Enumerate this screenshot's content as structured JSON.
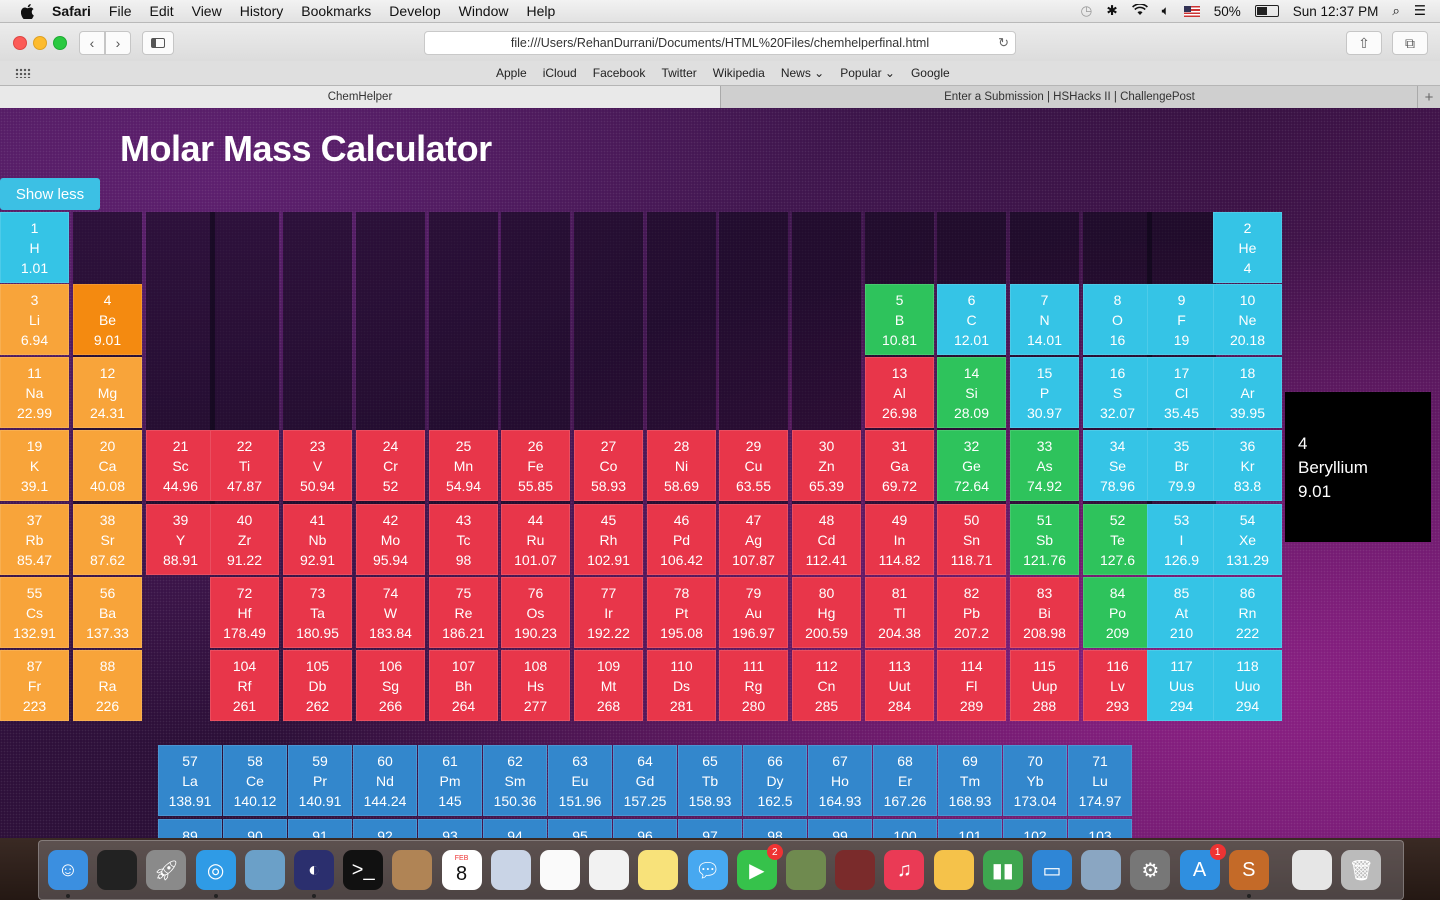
{
  "menubar": {
    "items": [
      "Safari",
      "File",
      "Edit",
      "View",
      "History",
      "Bookmarks",
      "Develop",
      "Window",
      "Help"
    ],
    "battery": "50%",
    "clock": "Sun 12:37 PM"
  },
  "toolbar": {
    "url": "file:///Users/RehanDurrani/Documents/HTML%20Files/chemhelperfinal.html"
  },
  "favorites": [
    "Apple",
    "iCloud",
    "Facebook",
    "Twitter",
    "Wikipedia",
    "News ⌄",
    "Popular ⌄",
    "Google"
  ],
  "tabs": [
    {
      "label": "ChemHelper",
      "active": true
    },
    {
      "label": "Enter a Submission | HSHacks II | ChallengePost",
      "active": false
    }
  ],
  "page": {
    "title": "Molar Mass Calculator",
    "show_less": "Show less"
  },
  "info_box": {
    "number": "4",
    "name": "Beryllium",
    "mass": "9.01"
  },
  "elements": [
    {
      "n": "1",
      "s": "H",
      "m": "1.01",
      "col": 1,
      "row": 1,
      "cat": "nonmetal"
    },
    {
      "n": "2",
      "s": "He",
      "m": "4",
      "col": 18,
      "row": 1,
      "cat": "nonmetal"
    },
    {
      "n": "3",
      "s": "Li",
      "m": "6.94",
      "col": 1,
      "row": 2,
      "cat": "alkali"
    },
    {
      "n": "4",
      "s": "Be",
      "m": "9.01",
      "col": 2,
      "row": 2,
      "cat": "selected"
    },
    {
      "n": "5",
      "s": "B",
      "m": "10.81",
      "col": 13,
      "row": 2,
      "cat": "metalloid"
    },
    {
      "n": "6",
      "s": "C",
      "m": "12.01",
      "col": 14,
      "row": 2,
      "cat": "nonmetal"
    },
    {
      "n": "7",
      "s": "N",
      "m": "14.01",
      "col": 15,
      "row": 2,
      "cat": "nonmetal"
    },
    {
      "n": "8",
      "s": "O",
      "m": "16",
      "col": 16,
      "row": 2,
      "cat": "nonmetal"
    },
    {
      "n": "9",
      "s": "F",
      "m": "19",
      "col": 17,
      "row": 2,
      "cat": "nonmetal"
    },
    {
      "n": "10",
      "s": "Ne",
      "m": "20.18",
      "col": 18,
      "row": 2,
      "cat": "nonmetal"
    },
    {
      "n": "11",
      "s": "Na",
      "m": "22.99",
      "col": 1,
      "row": 3,
      "cat": "alkali"
    },
    {
      "n": "12",
      "s": "Mg",
      "m": "24.31",
      "col": 2,
      "row": 3,
      "cat": "alkaline"
    },
    {
      "n": "13",
      "s": "Al",
      "m": "26.98",
      "col": 13,
      "row": 3,
      "cat": "transition"
    },
    {
      "n": "14",
      "s": "Si",
      "m": "28.09",
      "col": 14,
      "row": 3,
      "cat": "metalloid"
    },
    {
      "n": "15",
      "s": "P",
      "m": "30.97",
      "col": 15,
      "row": 3,
      "cat": "nonmetal"
    },
    {
      "n": "16",
      "s": "S",
      "m": "32.07",
      "col": 16,
      "row": 3,
      "cat": "nonmetal"
    },
    {
      "n": "17",
      "s": "Cl",
      "m": "35.45",
      "col": 17,
      "row": 3,
      "cat": "nonmetal"
    },
    {
      "n": "18",
      "s": "Ar",
      "m": "39.95",
      "col": 18,
      "row": 3,
      "cat": "nonmetal"
    },
    {
      "n": "19",
      "s": "K",
      "m": "39.1",
      "col": 1,
      "row": 4,
      "cat": "alkali"
    },
    {
      "n": "20",
      "s": "Ca",
      "m": "40.08",
      "col": 2,
      "row": 4,
      "cat": "alkaline"
    },
    {
      "n": "21",
      "s": "Sc",
      "m": "44.96",
      "col": 3,
      "row": 4,
      "cat": "transition"
    },
    {
      "n": "22",
      "s": "Ti",
      "m": "47.87",
      "col": 4,
      "row": 4,
      "cat": "transition"
    },
    {
      "n": "23",
      "s": "V",
      "m": "50.94",
      "col": 5,
      "row": 4,
      "cat": "transition"
    },
    {
      "n": "24",
      "s": "Cr",
      "m": "52",
      "col": 6,
      "row": 4,
      "cat": "transition"
    },
    {
      "n": "25",
      "s": "Mn",
      "m": "54.94",
      "col": 7,
      "row": 4,
      "cat": "transition"
    },
    {
      "n": "26",
      "s": "Fe",
      "m": "55.85",
      "col": 8,
      "row": 4,
      "cat": "transition"
    },
    {
      "n": "27",
      "s": "Co",
      "m": "58.93",
      "col": 9,
      "row": 4,
      "cat": "transition"
    },
    {
      "n": "28",
      "s": "Ni",
      "m": "58.69",
      "col": 10,
      "row": 4,
      "cat": "transition"
    },
    {
      "n": "29",
      "s": "Cu",
      "m": "63.55",
      "col": 11,
      "row": 4,
      "cat": "transition"
    },
    {
      "n": "30",
      "s": "Zn",
      "m": "65.39",
      "col": 12,
      "row": 4,
      "cat": "transition"
    },
    {
      "n": "31",
      "s": "Ga",
      "m": "69.72",
      "col": 13,
      "row": 4,
      "cat": "transition"
    },
    {
      "n": "32",
      "s": "Ge",
      "m": "72.64",
      "col": 14,
      "row": 4,
      "cat": "metalloid"
    },
    {
      "n": "33",
      "s": "As",
      "m": "74.92",
      "col": 15,
      "row": 4,
      "cat": "metalloid"
    },
    {
      "n": "34",
      "s": "Se",
      "m": "78.96",
      "col": 16,
      "row": 4,
      "cat": "nonmetal"
    },
    {
      "n": "35",
      "s": "Br",
      "m": "79.9",
      "col": 17,
      "row": 4,
      "cat": "nonmetal"
    },
    {
      "n": "36",
      "s": "Kr",
      "m": "83.8",
      "col": 18,
      "row": 4,
      "cat": "nonmetal"
    },
    {
      "n": "37",
      "s": "Rb",
      "m": "85.47",
      "col": 1,
      "row": 5,
      "cat": "alkali"
    },
    {
      "n": "38",
      "s": "Sr",
      "m": "87.62",
      "col": 2,
      "row": 5,
      "cat": "alkaline"
    },
    {
      "n": "39",
      "s": "Y",
      "m": "88.91",
      "col": 3,
      "row": 5,
      "cat": "transition"
    },
    {
      "n": "40",
      "s": "Zr",
      "m": "91.22",
      "col": 4,
      "row": 5,
      "cat": "transition"
    },
    {
      "n": "41",
      "s": "Nb",
      "m": "92.91",
      "col": 5,
      "row": 5,
      "cat": "transition"
    },
    {
      "n": "42",
      "s": "Mo",
      "m": "95.94",
      "col": 6,
      "row": 5,
      "cat": "transition"
    },
    {
      "n": "43",
      "s": "Tc",
      "m": "98",
      "col": 7,
      "row": 5,
      "cat": "transition"
    },
    {
      "n": "44",
      "s": "Ru",
      "m": "101.07",
      "col": 8,
      "row": 5,
      "cat": "transition"
    },
    {
      "n": "45",
      "s": "Rh",
      "m": "102.91",
      "col": 9,
      "row": 5,
      "cat": "transition"
    },
    {
      "n": "46",
      "s": "Pd",
      "m": "106.42",
      "col": 10,
      "row": 5,
      "cat": "transition"
    },
    {
      "n": "47",
      "s": "Ag",
      "m": "107.87",
      "col": 11,
      "row": 5,
      "cat": "transition"
    },
    {
      "n": "48",
      "s": "Cd",
      "m": "112.41",
      "col": 12,
      "row": 5,
      "cat": "transition"
    },
    {
      "n": "49",
      "s": "In",
      "m": "114.82",
      "col": 13,
      "row": 5,
      "cat": "transition"
    },
    {
      "n": "50",
      "s": "Sn",
      "m": "118.71",
      "col": 14,
      "row": 5,
      "cat": "transition"
    },
    {
      "n": "51",
      "s": "Sb",
      "m": "121.76",
      "col": 15,
      "row": 5,
      "cat": "metalloid"
    },
    {
      "n": "52",
      "s": "Te",
      "m": "127.6",
      "col": 16,
      "row": 5,
      "cat": "metalloid"
    },
    {
      "n": "53",
      "s": "I",
      "m": "126.9",
      "col": 17,
      "row": 5,
      "cat": "nonmetal"
    },
    {
      "n": "54",
      "s": "Xe",
      "m": "131.29",
      "col": 18,
      "row": 5,
      "cat": "nonmetal"
    },
    {
      "n": "55",
      "s": "Cs",
      "m": "132.91",
      "col": 1,
      "row": 6,
      "cat": "alkali"
    },
    {
      "n": "56",
      "s": "Ba",
      "m": "137.33",
      "col": 2,
      "row": 6,
      "cat": "alkaline"
    },
    {
      "n": "72",
      "s": "Hf",
      "m": "178.49",
      "col": 4,
      "row": 6,
      "cat": "transition"
    },
    {
      "n": "73",
      "s": "Ta",
      "m": "180.95",
      "col": 5,
      "row": 6,
      "cat": "transition"
    },
    {
      "n": "74",
      "s": "W",
      "m": "183.84",
      "col": 6,
      "row": 6,
      "cat": "transition"
    },
    {
      "n": "75",
      "s": "Re",
      "m": "186.21",
      "col": 7,
      "row": 6,
      "cat": "transition"
    },
    {
      "n": "76",
      "s": "Os",
      "m": "190.23",
      "col": 8,
      "row": 6,
      "cat": "transition"
    },
    {
      "n": "77",
      "s": "Ir",
      "m": "192.22",
      "col": 9,
      "row": 6,
      "cat": "transition"
    },
    {
      "n": "78",
      "s": "Pt",
      "m": "195.08",
      "col": 10,
      "row": 6,
      "cat": "transition"
    },
    {
      "n": "79",
      "s": "Au",
      "m": "196.97",
      "col": 11,
      "row": 6,
      "cat": "transition"
    },
    {
      "n": "80",
      "s": "Hg",
      "m": "200.59",
      "col": 12,
      "row": 6,
      "cat": "transition"
    },
    {
      "n": "81",
      "s": "Tl",
      "m": "204.38",
      "col": 13,
      "row": 6,
      "cat": "transition"
    },
    {
      "n": "82",
      "s": "Pb",
      "m": "207.2",
      "col": 14,
      "row": 6,
      "cat": "transition"
    },
    {
      "n": "83",
      "s": "Bi",
      "m": "208.98",
      "col": 15,
      "row": 6,
      "cat": "transition"
    },
    {
      "n": "84",
      "s": "Po",
      "m": "209",
      "col": 16,
      "row": 6,
      "cat": "metalloid"
    },
    {
      "n": "85",
      "s": "At",
      "m": "210",
      "col": 17,
      "row": 6,
      "cat": "nonmetal"
    },
    {
      "n": "86",
      "s": "Rn",
      "m": "222",
      "col": 18,
      "row": 6,
      "cat": "nonmetal"
    },
    {
      "n": "87",
      "s": "Fr",
      "m": "223",
      "col": 1,
      "row": 7,
      "cat": "alkali"
    },
    {
      "n": "88",
      "s": "Ra",
      "m": "226",
      "col": 2,
      "row": 7,
      "cat": "alkaline"
    },
    {
      "n": "104",
      "s": "Rf",
      "m": "261",
      "col": 4,
      "row": 7,
      "cat": "transition"
    },
    {
      "n": "105",
      "s": "Db",
      "m": "262",
      "col": 5,
      "row": 7,
      "cat": "transition"
    },
    {
      "n": "106",
      "s": "Sg",
      "m": "266",
      "col": 6,
      "row": 7,
      "cat": "transition"
    },
    {
      "n": "107",
      "s": "Bh",
      "m": "264",
      "col": 7,
      "row": 7,
      "cat": "transition"
    },
    {
      "n": "108",
      "s": "Hs",
      "m": "277",
      "col": 8,
      "row": 7,
      "cat": "transition"
    },
    {
      "n": "109",
      "s": "Mt",
      "m": "268",
      "col": 9,
      "row": 7,
      "cat": "transition"
    },
    {
      "n": "110",
      "s": "Ds",
      "m": "281",
      "col": 10,
      "row": 7,
      "cat": "transition"
    },
    {
      "n": "111",
      "s": "Rg",
      "m": "280",
      "col": 11,
      "row": 7,
      "cat": "transition"
    },
    {
      "n": "112",
      "s": "Cn",
      "m": "285",
      "col": 12,
      "row": 7,
      "cat": "transition"
    },
    {
      "n": "113",
      "s": "Uut",
      "m": "284",
      "col": 13,
      "row": 7,
      "cat": "transition"
    },
    {
      "n": "114",
      "s": "Fl",
      "m": "289",
      "col": 14,
      "row": 7,
      "cat": "transition"
    },
    {
      "n": "115",
      "s": "Uup",
      "m": "288",
      "col": 15,
      "row": 7,
      "cat": "transition"
    },
    {
      "n": "116",
      "s": "Lv",
      "m": "293",
      "col": 16,
      "row": 7,
      "cat": "transition"
    },
    {
      "n": "117",
      "s": "Uus",
      "m": "294",
      "col": 17,
      "row": 7,
      "cat": "nonmetal"
    },
    {
      "n": "118",
      "s": "Uuo",
      "m": "294",
      "col": 18,
      "row": 7,
      "cat": "nonmetal"
    }
  ],
  "lanthanides": [
    {
      "n": "57",
      "s": "La",
      "m": "138.91"
    },
    {
      "n": "58",
      "s": "Ce",
      "m": "140.12"
    },
    {
      "n": "59",
      "s": "Pr",
      "m": "140.91"
    },
    {
      "n": "60",
      "s": "Nd",
      "m": "144.24"
    },
    {
      "n": "61",
      "s": "Pm",
      "m": "145"
    },
    {
      "n": "62",
      "s": "Sm",
      "m": "150.36"
    },
    {
      "n": "63",
      "s": "Eu",
      "m": "151.96"
    },
    {
      "n": "64",
      "s": "Gd",
      "m": "157.25"
    },
    {
      "n": "65",
      "s": "Tb",
      "m": "158.93"
    },
    {
      "n": "66",
      "s": "Dy",
      "m": "162.5"
    },
    {
      "n": "67",
      "s": "Ho",
      "m": "164.93"
    },
    {
      "n": "68",
      "s": "Er",
      "m": "167.26"
    },
    {
      "n": "69",
      "s": "Tm",
      "m": "168.93"
    },
    {
      "n": "70",
      "s": "Yb",
      "m": "173.04"
    },
    {
      "n": "71",
      "s": "Lu",
      "m": "174.97"
    }
  ],
  "actinides": [
    {
      "n": "89"
    },
    {
      "n": "90"
    },
    {
      "n": "91"
    },
    {
      "n": "92"
    },
    {
      "n": "93"
    },
    {
      "n": "94"
    },
    {
      "n": "95"
    },
    {
      "n": "96"
    },
    {
      "n": "97"
    },
    {
      "n": "98"
    },
    {
      "n": "99"
    },
    {
      "n": "100"
    },
    {
      "n": "101"
    },
    {
      "n": "102"
    },
    {
      "n": "103"
    }
  ],
  "colors": {
    "alkali": "#f8a43a",
    "selected": "#f48a10",
    "transition": "#e8364a",
    "nonmetal": "#35c4e6",
    "metalloid": "#2ec35c",
    "lanthanide": "#3387cc"
  },
  "dock": {
    "icons": [
      "finder-icon",
      "activity-monitor-icon",
      "launchpad-icon",
      "safari-icon",
      "preview-icon",
      "eclipse-icon",
      "terminal-icon",
      "contacts-icon",
      "calendar-icon",
      "photo-booth-icon",
      "reminders-icon",
      "textedit-icon",
      "notes-icon",
      "messages-icon",
      "facetime-icon",
      "photos-icon",
      "photo-booth-2-icon",
      "itunes-icon",
      "pages-icon",
      "numbers-icon",
      "keynote-icon",
      "iphoto-icon",
      "system-preferences-icon",
      "app-store-icon",
      "sublime-text-icon",
      "document-icon",
      "trash-icon"
    ],
    "calendar_month": "FEB",
    "calendar_day": "8",
    "facetime_badge": "2",
    "appstore_badge": "1"
  }
}
